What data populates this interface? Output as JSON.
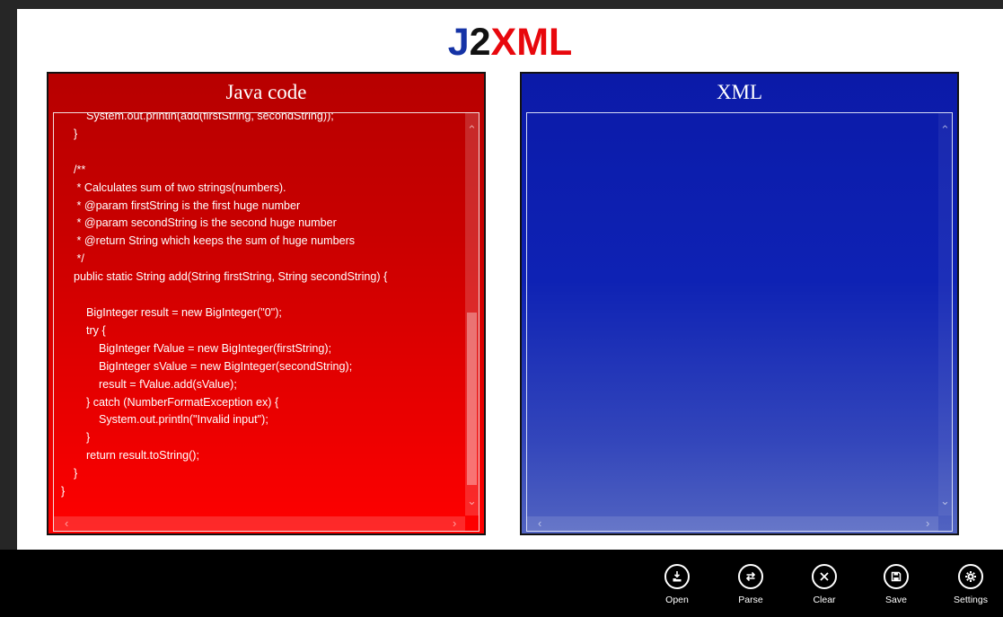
{
  "app": {
    "title_j": "J",
    "title_2": "2",
    "title_xml": "XML"
  },
  "java_panel": {
    "title": "Java code",
    "code": "        System.out.println(add(firstString, secondString));\n    }\n\n    /**\n     * Calculates sum of two strings(numbers).\n     * @param firstString is the first huge number\n     * @param secondString is the second huge number\n     * @return String which keeps the sum of huge numbers\n     */\n    public static String add(String firstString, String secondString) {\n\n        BigInteger result = new BigInteger(\"0\");\n        try {\n            BigInteger fValue = new BigInteger(firstString);\n            BigInteger sValue = new BigInteger(secondString);\n            result = fValue.add(sValue);\n        } catch (NumberFormatException ex) {\n            System.out.println(\"Invalid input\");\n        }\n        return result.toString();\n    }\n}"
  },
  "xml_panel": {
    "title": "XML",
    "content": ""
  },
  "app_bar": {
    "buttons": [
      {
        "label": "Open",
        "icon": "open-icon"
      },
      {
        "label": "Parse",
        "icon": "parse-icon"
      },
      {
        "label": "Clear",
        "icon": "clear-icon"
      },
      {
        "label": "Save",
        "icon": "save-icon"
      },
      {
        "label": "Settings",
        "icon": "gear-icon"
      }
    ]
  },
  "colors": {
    "java_panel_bg": "#d40000",
    "xml_panel_bg": "#0e22b4",
    "title_j": "#1533a6",
    "title_xml": "#e8080d",
    "app_bar_bg": "#000000"
  }
}
